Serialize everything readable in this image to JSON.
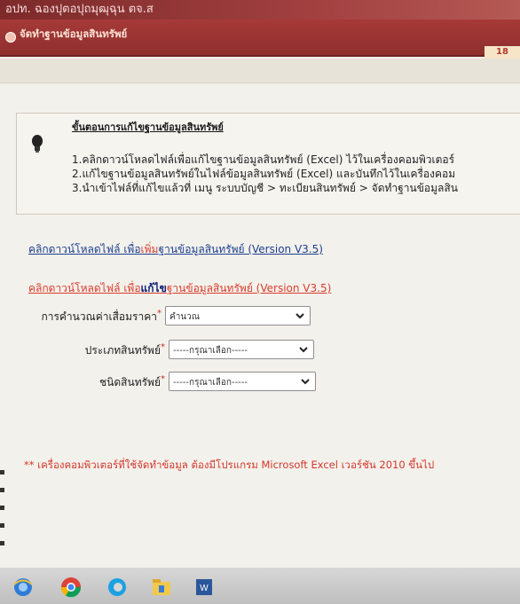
{
  "top_banner_text": "อปท. ฉองปุตอปุถมุฒุฉุน ตจ.ส",
  "section": {
    "title": "จัดทำฐานข้อมูลสินทรัพย์",
    "counter": "18"
  },
  "instructions": {
    "heading": "ขั้นตอนการแก้ไขฐานข้อมูลสินทรัพย์",
    "steps": [
      "1.คลิกดาวน์โหลดไฟล์เพื่อแก้ไขฐานข้อมูลสินทรัพย์ (Excel) ไว้ในเครื่องคอมพิวเตอร์",
      "2.แก้ไขฐานข้อมูลสินทรัพย์ในไฟล์ข้อมูลสินทรัพย์ (Excel) และบันทึกไว้ในเครื่องคอม",
      "3.นำเข้าไฟล์ที่แก้ไขแล้วที่ เมนู ระบบบัญชี > ทะเบียนสินทรัพย์ > จัดทำฐานข้อมูลสิน"
    ]
  },
  "links": {
    "add": {
      "pre": "คลิกดาวน์โหลดไฟล์ เพื่อ",
      "highlight": "เพิ่ม",
      "post": "ฐานข้อมูลสินทรัพย์ (Version V3.5)"
    },
    "edit": {
      "pre": "คลิกดาวน์โหลดไฟล์ เพื่อ",
      "highlight": "แก้ไข",
      "post": "ฐานข้อมูลสินทรัพย์ (Version V3.5)"
    }
  },
  "form": {
    "depreciation": {
      "label": "การคำนวณค่าเสื่อมราคา",
      "required": "*",
      "value": "คำนวณ"
    },
    "asset_type": {
      "label": "ประเภทสินทรัพย์",
      "required": "*",
      "value": "-----กรุณาเลือก-----"
    },
    "asset_kind": {
      "label": "ชนิดสินทรัพย์",
      "required": "*",
      "value": "-----กรุณาเลือก-----"
    }
  },
  "note": "** เครื่องคอมพิวเตอร์ที่ใช้จัดทำข้อมูล ต้องมีโปรแกรม Microsoft Excel เวอร์ชัน 2010 ขึ้นไป",
  "colors": {
    "header": "#9b3534",
    "link_blue": "#1c3f8f",
    "link_red": "#d93d2c",
    "required": "#d0302a"
  },
  "taskbar_icons": [
    "ie-icon",
    "chrome-icon",
    "edge-icon",
    "file-explorer-icon",
    "word-icon"
  ]
}
